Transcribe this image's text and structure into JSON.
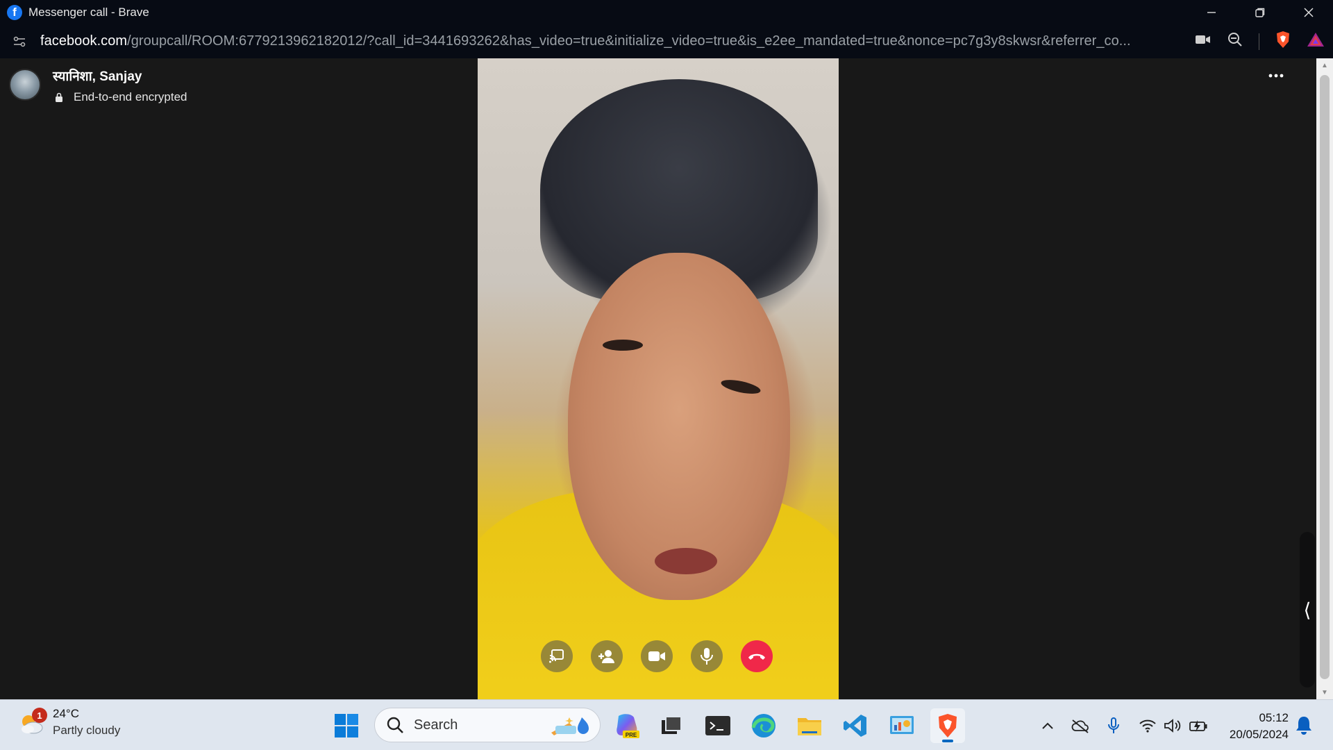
{
  "window": {
    "title": "Messenger call - Brave",
    "app_icon": "facebook-icon",
    "controls": [
      "minimize",
      "restore",
      "close"
    ]
  },
  "addressbar": {
    "host": "facebook.com",
    "path": "/groupcall/ROOM:6779213962182012/?call_id=3441693262&has_video=true&initialize_video=true&is_e2ee_mandated=true&nonce=pc7g3y8skwsr&referrer_co...",
    "icons": [
      "site-settings-icon",
      "camera-icon",
      "zoom-icon",
      "brave-shields-icon",
      "brave-rewards-icon"
    ]
  },
  "call": {
    "participants": "स्यानिशा, Sanjay",
    "encryption": "End-to-end encrypted",
    "controls": [
      "share-screen",
      "add-person",
      "video",
      "microphone",
      "end-call"
    ],
    "end_color": "#f02849"
  },
  "taskbar": {
    "weather": {
      "badge": "1",
      "temp": "24°C",
      "condition": "Partly cloudy"
    },
    "search_label": "Search",
    "apps": [
      "windows-start",
      "copilot-preview",
      "task-view",
      "terminal",
      "edge",
      "file-explorer",
      "vscode",
      "control-panel",
      "brave"
    ],
    "active_app": "brave",
    "tray": [
      "chevron-up",
      "onedrive",
      "microphone",
      "wifi",
      "volume",
      "battery"
    ],
    "time": "05:12",
    "date": "20/05/2024"
  },
  "colors": {
    "accent": "#0067c0",
    "fb_blue": "#1877f2",
    "brave_orange": "#fb542b"
  }
}
